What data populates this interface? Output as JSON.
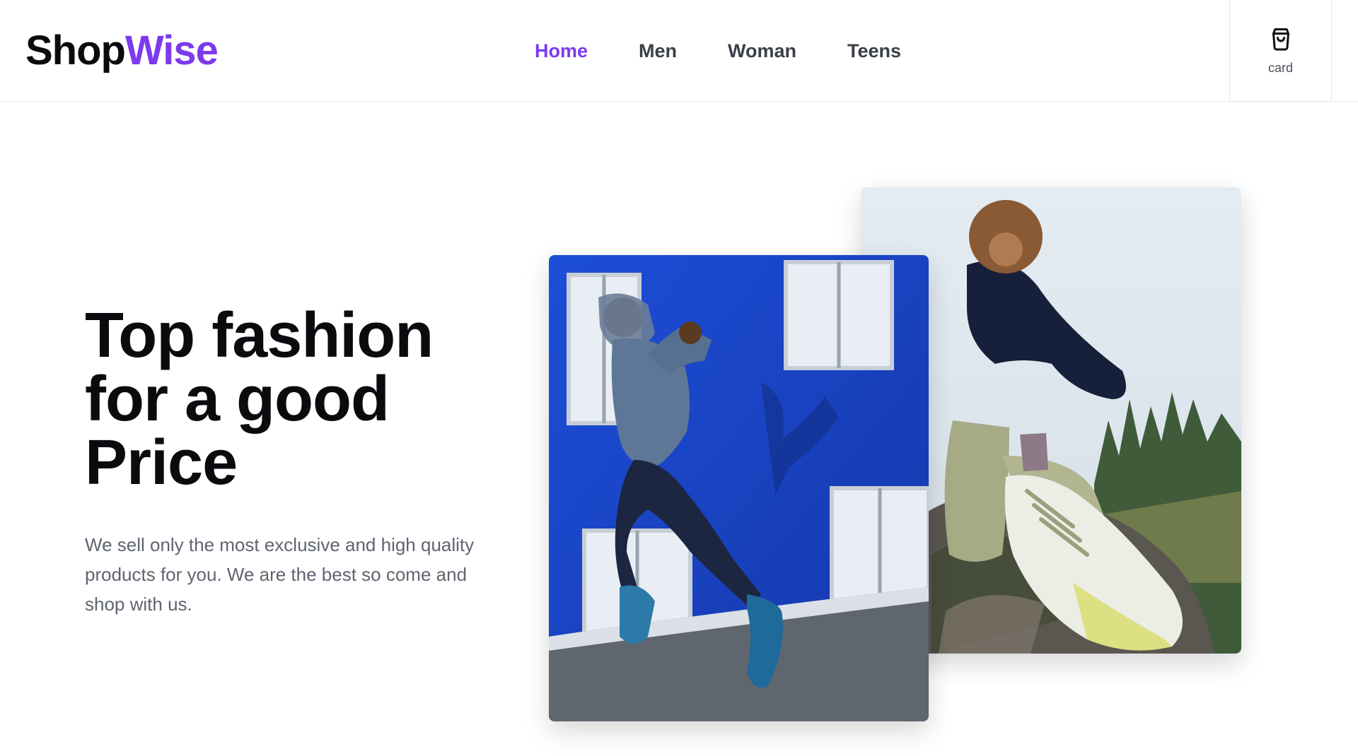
{
  "brand": {
    "part1": "Shop",
    "part2": "Wise"
  },
  "nav": {
    "items": [
      {
        "label": "Home",
        "active": true
      },
      {
        "label": "Men",
        "active": false
      },
      {
        "label": "Woman",
        "active": false
      },
      {
        "label": "Teens",
        "active": false
      }
    ]
  },
  "cart": {
    "icon": "shopping-bag-icon",
    "label": "card"
  },
  "hero": {
    "title_lines": [
      "Top fashion",
      "for a good",
      "Price"
    ],
    "description": "We sell only the most exclusive and high quality products for you. We are the best so come and shop with us."
  },
  "images": {
    "front": "runner-blue-wall-photo",
    "back": "woman-sitting-rock-sneakers-photo"
  },
  "colors": {
    "accent": "#7c3aed",
    "text": "#0b0b0f",
    "muted": "#5f6470"
  }
}
